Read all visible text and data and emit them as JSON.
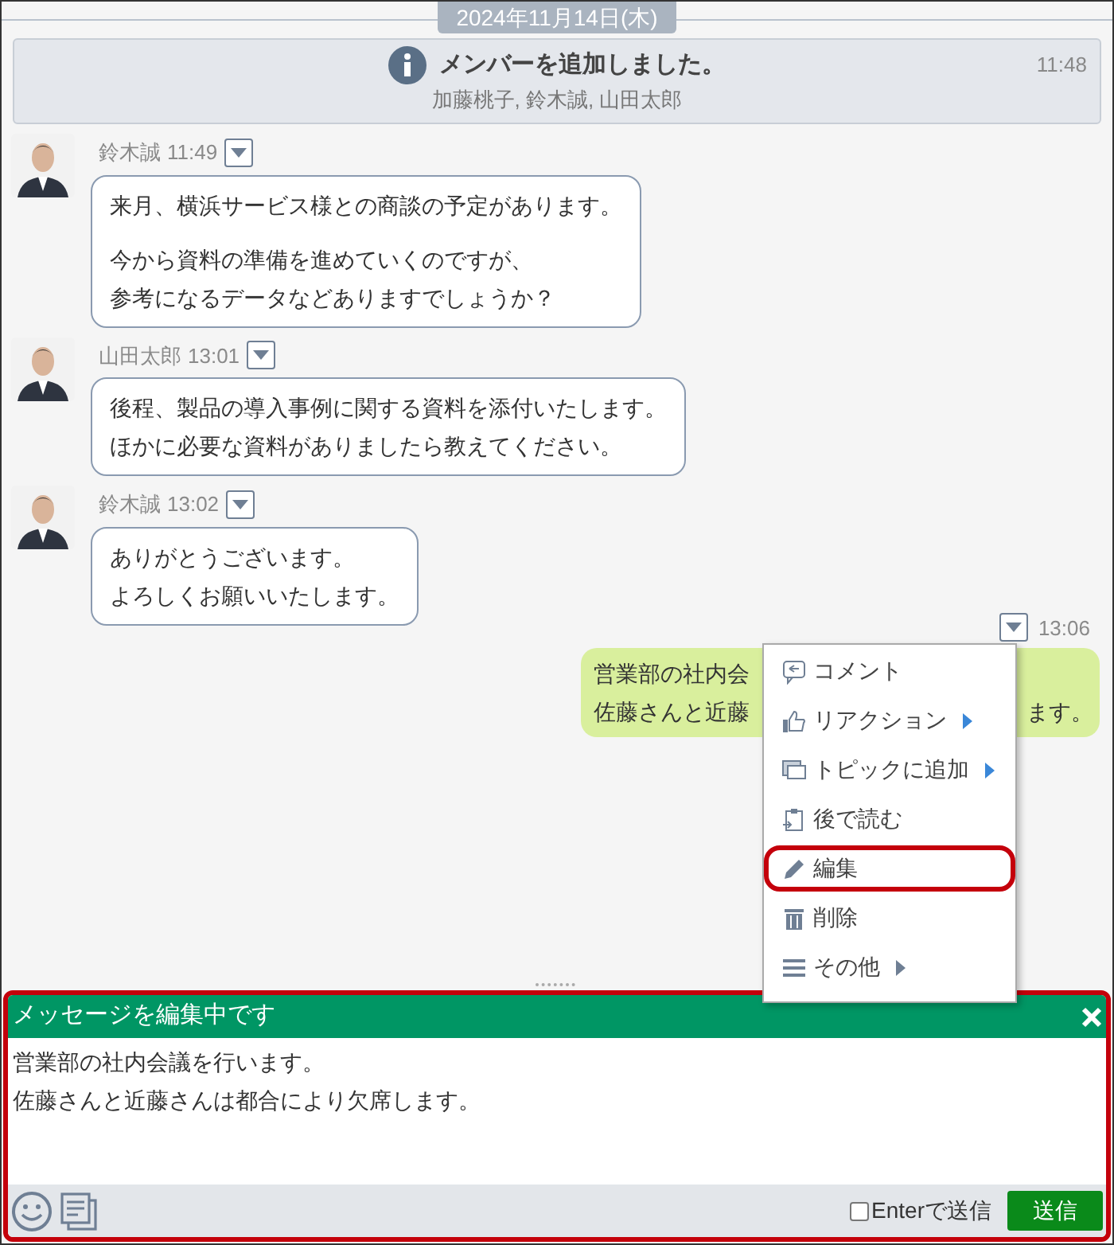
{
  "date_separator": "2024年11月14日(木)",
  "notice": {
    "title": "メンバーを追加しました。",
    "members": "加藤桃子, 鈴木誠, 山田太郎",
    "time": "11:48"
  },
  "messages": [
    {
      "author": "鈴木誠",
      "time": "11:49",
      "paragraphs": [
        [
          "来月、横浜サービス様との商談の予定があります。"
        ],
        [
          "今から資料の準備を進めていくのですが、",
          "参考になるデータなどありますでしょうか？"
        ]
      ]
    },
    {
      "author": "山田太郎",
      "time": "13:01",
      "paragraphs": [
        [
          "後程、製品の導入事例に関する資料を添付いたします。",
          "ほかに必要な資料がありましたら教えてください。"
        ]
      ]
    },
    {
      "author": "鈴木誠",
      "time": "13:02",
      "paragraphs": [
        [
          "ありがとうございます。",
          "よろしくお願いいたします。"
        ]
      ]
    }
  ],
  "own_message": {
    "time": "13:06",
    "visible_left": [
      "営業部の社内会",
      "佐藤さんと近藤"
    ],
    "visible_right": "ます。"
  },
  "context_menu": [
    {
      "label": "コメント",
      "submenu": false,
      "highlighted": false
    },
    {
      "label": "リアクション",
      "submenu": true,
      "highlighted": false
    },
    {
      "label": "トピックに追加",
      "submenu": true,
      "highlighted": false
    },
    {
      "label": "後で読む",
      "submenu": false,
      "highlighted": false
    },
    {
      "label": "編集",
      "submenu": false,
      "highlighted": true
    },
    {
      "label": "削除",
      "submenu": false,
      "highlighted": false
    },
    {
      "label": "その他",
      "submenu": true,
      "highlighted": false
    }
  ],
  "editor": {
    "header": "メッセージを編集中です",
    "text": [
      "営業部の社内会議を行います。",
      "佐藤さんと近藤さんは都合により欠席します。"
    ],
    "enter_to_send": {
      "label": "Enterで送信",
      "checked": false
    },
    "send_button": "送信"
  }
}
